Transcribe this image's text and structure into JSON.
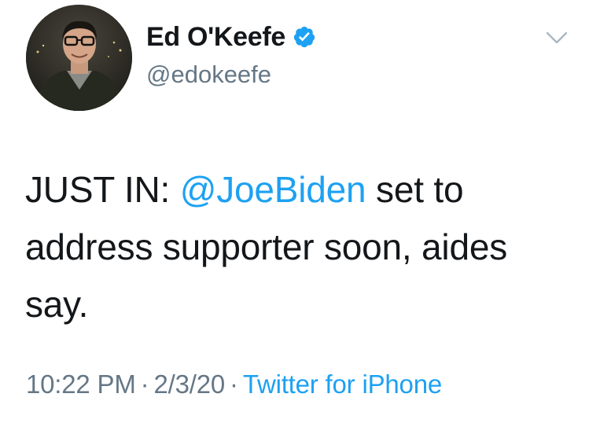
{
  "user": {
    "display_name": "Ed O'Keefe",
    "handle": "@edokeefe",
    "verified_icon": "verified-badge-icon",
    "avatar_icon": "profile-photo"
  },
  "tweet": {
    "prefix": "JUST IN: ",
    "mention": "@JoeBiden",
    "suffix": " set to address supporter soon, aides say."
  },
  "meta": {
    "time": "10:22 PM",
    "separator": "·",
    "date": "2/3/20",
    "source": "Twitter for iPhone"
  },
  "colors": {
    "accent": "#1da1f2",
    "text": "#14171a",
    "secondary": "#657786"
  },
  "icons": {
    "menu": "chevron-down-icon"
  }
}
